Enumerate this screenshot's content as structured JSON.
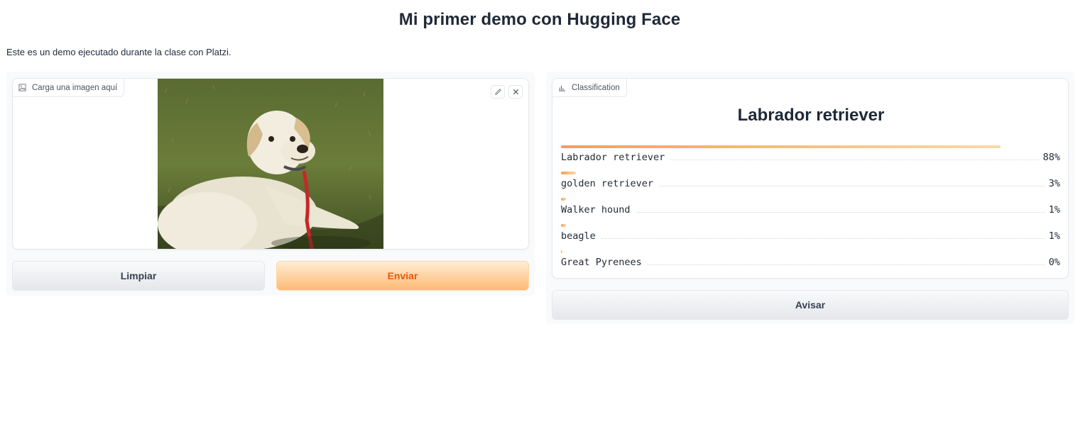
{
  "page": {
    "title": "Mi primer demo con Hugging Face",
    "description": "Este es un demo ejecutado durante la clase con Platzi."
  },
  "input": {
    "image_label": "Carga una imagen aquí",
    "image_icon": "image-icon",
    "edit_icon": "pencil-icon",
    "clear_icon": "close-icon",
    "clear_button": "Limpiar",
    "submit_button": "Enviar"
  },
  "output": {
    "label": "Classification",
    "label_icon": "bar-chart-icon",
    "top_prediction": "Labrador retriever",
    "confidences": [
      {
        "name": "Labrador retriever",
        "percent": "88%",
        "value": 0.88
      },
      {
        "name": "golden retriever",
        "percent": "3%",
        "value": 0.03
      },
      {
        "name": "Walker hound",
        "percent": "1%",
        "value": 0.01
      },
      {
        "name": "beagle",
        "percent": "1%",
        "value": 0.01
      },
      {
        "name": "Great Pyrenees",
        "percent": "0%",
        "value": 0.0
      }
    ],
    "flag_button": "Avisar"
  },
  "colors": {
    "accent": "#ea580c",
    "bar_start": "#f59e53",
    "bar_end": "#fcd9a8"
  }
}
